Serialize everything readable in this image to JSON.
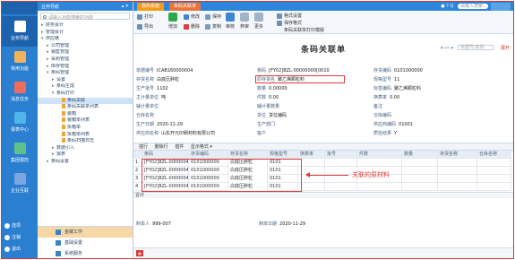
{
  "rail": {
    "items": [
      {
        "label": "业务导航",
        "color": "#ffffff"
      },
      {
        "label": "常用功能",
        "color": "#f2b35a"
      },
      {
        "label": "消息任务",
        "color": "#ef6b5b"
      },
      {
        "label": "报表中心",
        "color": "#4fb4e8"
      },
      {
        "label": "集团报控",
        "color": "#5ec08a"
      },
      {
        "label": "企业互联",
        "color": "#7aa6e2"
      }
    ],
    "bottom": [
      "选项",
      "注销",
      "退出"
    ]
  },
  "nav": {
    "title": "业务导航",
    "search_placeholder": "请输入功能搜索的功能",
    "tree": [
      {
        "label": "财务会计",
        "level": 0,
        "caret": "▸"
      },
      {
        "label": "管理会计",
        "level": 0,
        "caret": "▸"
      },
      {
        "label": "供应链",
        "level": 0,
        "caret": "▾"
      },
      {
        "label": "公司管理",
        "level": 1,
        "caret": "▸"
      },
      {
        "label": "销售管理",
        "level": 1,
        "caret": "▸"
      },
      {
        "label": "采购管理",
        "level": 1,
        "caret": "▸"
      },
      {
        "label": "库存管理",
        "level": 1,
        "caret": "▸"
      },
      {
        "label": "条码管理",
        "level": 1,
        "caret": "▾"
      },
      {
        "label": "设置",
        "level": 2,
        "caret": "▸"
      },
      {
        "label": "条码生成",
        "level": 2,
        "caret": "▸"
      },
      {
        "label": "条码打印",
        "level": 2,
        "caret": "▾"
      },
      {
        "label": "条码关联",
        "level": 3,
        "caret": "",
        "selected": true
      },
      {
        "label": "条码关联单列表",
        "level": 3,
        "caret": ""
      },
      {
        "label": "装箱",
        "level": 3,
        "caret": ""
      },
      {
        "label": "装箱单列表",
        "level": 3,
        "caret": ""
      },
      {
        "label": "拆箱单",
        "level": 3,
        "caret": ""
      },
      {
        "label": "拆箱单列表",
        "level": 3,
        "caret": ""
      },
      {
        "label": "条码扫描日志",
        "level": 3,
        "caret": ""
      },
      {
        "label": "数据引入",
        "level": 2,
        "caret": "▸"
      },
      {
        "label": "报表",
        "level": 2,
        "caret": "▸"
      },
      {
        "label": "条码设置",
        "level": 1,
        "caret": "▸"
      }
    ],
    "footer": [
      "金蝶工作",
      "基础设置",
      "系统服务"
    ]
  },
  "topbar": {
    "tabs": [
      "我的桌面",
      "条码关联单"
    ],
    "right_icons": [
      "●",
      "?",
      "Q"
    ],
    "search_placeholder": "请输入搜索..."
  },
  "toolbar": {
    "print": "打印",
    "export": "导出",
    "add": "增加",
    "modify": "修改",
    "delete": "删除",
    "save": "保存",
    "copy": "复制",
    "audit": "审核",
    "unaudit": "弃审",
    "more": "更多",
    "format_set": "格式设置",
    "save_format": "保存格式",
    "relate_print": "条码关联单打印模版"
  },
  "form": {
    "title": "条码关联单",
    "pager": "◂ ◃ ▹ ▸",
    "pager_search": "单据号/条码",
    "toggle": "展开",
    "fields": [
      {
        "label": "单据编号",
        "value": "ICAB160000004",
        "key": "doc_no"
      },
      {
        "label": "条码",
        "value": "[FY02]BZL-00000000[0010",
        "key": "barcode"
      },
      {
        "label": "存货编码",
        "value": "0101000000",
        "key": "inv_code"
      },
      {
        "label": "存货名称",
        "value": "白底压胖粒",
        "key": "inv_name"
      },
      {
        "label": "原存货名",
        "value": "聚乙烯颗粒料",
        "key": "orig_name"
      },
      {
        "label": "规格型号",
        "value": "11",
        "key": "spec"
      },
      {
        "label": "生产批号",
        "value": "1102",
        "key": "batch"
      },
      {
        "label": "数量",
        "value": "0.00000",
        "key": "qty"
      },
      {
        "label": "标签编码",
        "value": "聚乙烯颗粒料",
        "key": "tag"
      },
      {
        "label": "主计量单位",
        "value": "吨",
        "key": "unit"
      },
      {
        "label": "件数",
        "value": "0.00",
        "key": "pieces"
      },
      {
        "label": "换算率",
        "value": "0.00",
        "key": "rate"
      },
      {
        "label": "辅计量单位",
        "value": "",
        "key": "aux_unit"
      },
      {
        "label": "辅计量数量",
        "value": "",
        "key": "aux_qty"
      },
      {
        "label": "备注",
        "value": "",
        "key": "memo"
      },
      {
        "label": "仓库名称",
        "value": "",
        "key": "wh_name"
      },
      {
        "label": "货位",
        "value": "货位编码",
        "key": "loc"
      },
      {
        "label": "仓库编码",
        "value": "",
        "key": "wh_code"
      },
      {
        "label": "生产日期",
        "value": "2020-11-29",
        "key": "mfg_date"
      },
      {
        "label": "生产部门",
        "value": "",
        "key": "dept"
      },
      {
        "label": "供应商编码",
        "value": "01001",
        "key": "sup_code"
      },
      {
        "label": "供应商名称",
        "value": "山东开元印刷材料有限公司",
        "key": "sup_name"
      },
      {
        "label": "客户",
        "value": "",
        "key": "cust"
      },
      {
        "label": "质检结果",
        "value": "Y",
        "key": "qc"
      }
    ],
    "grid_bar": [
      "插行",
      "删除行",
      "插件",
      "显示格式 ▾",
      "显示格式 ▾"
    ],
    "columns": [
      "",
      "条码",
      "存货编码",
      "存货名称",
      "规格型号",
      "换算率",
      "批号",
      "件数",
      "数量",
      "存货名称",
      "仓库名称"
    ],
    "rows": [
      {
        "no": "1",
        "barcode": "[FY02]BZL-00000048[0",
        "inv_code": "0101000000",
        "inv_name": "白底压胖粒",
        "rate": "0101"
      },
      {
        "no": "2",
        "barcode": "[FY02]BZL-00000042[0",
        "inv_code": "0101000000",
        "inv_name": "白底压胖粒",
        "rate": "0101"
      },
      {
        "no": "3",
        "barcode": "[FY02]BZL-00000048[0",
        "inv_code": "0101000000",
        "inv_name": "白底压胖粒",
        "rate": "0101"
      },
      {
        "no": "4",
        "barcode": "[FY02]BZL-00000043[0",
        "inv_code": "0101000000",
        "inv_name": "白底压胖粒",
        "rate": "0101"
      }
    ],
    "total_label": "合计",
    "annotation": "关联的原材料",
    "maker_label": "制单人",
    "maker": "999-007",
    "make_time_label": "制单日期",
    "make_time": "2020-11-29"
  }
}
